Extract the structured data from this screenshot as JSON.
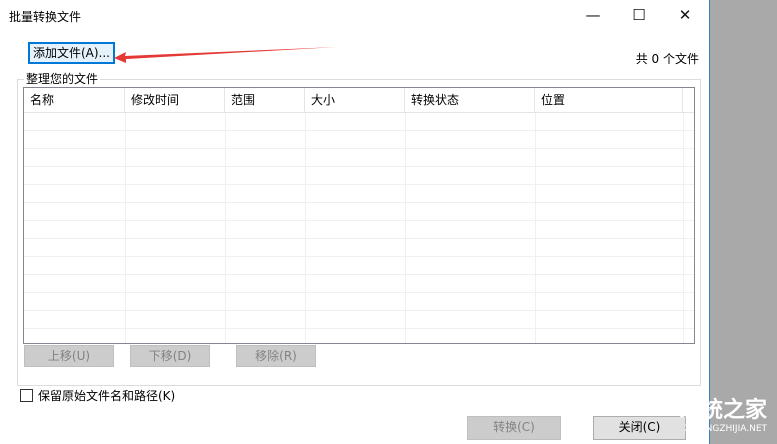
{
  "window": {
    "title": "批量转换文件",
    "minimize": "—",
    "maximize": "☐",
    "close": "✕"
  },
  "add_button": "添加文件(A)...",
  "file_count": "共 0 个文件",
  "group_label": "整理您的文件",
  "columns": [
    "名称",
    "修改时间",
    "范围",
    "大小",
    "转换状态",
    "位置"
  ],
  "move_up": "上移(U)",
  "move_down": "下移(D)",
  "remove": "移除(R)",
  "keep_path_checkbox": "保留原始文件名和路径(K)",
  "convert_button": "转换(C)",
  "close_button": "关闭(C)",
  "watermark": {
    "name": "系统之家",
    "url": "XITONGZHIJIA.NET"
  },
  "accent": "#0078d7",
  "arrow_color": "#e53935"
}
